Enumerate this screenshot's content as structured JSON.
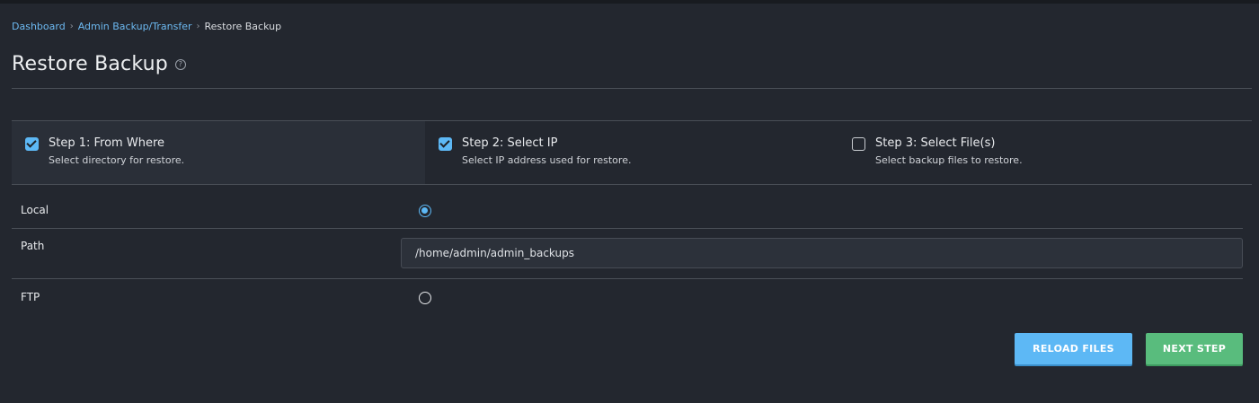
{
  "breadcrumb": {
    "items": [
      "Dashboard",
      "Admin Backup/Transfer"
    ],
    "current": "Restore Backup"
  },
  "page": {
    "title": "Restore Backup"
  },
  "steps": [
    {
      "title": "Step 1: From Where",
      "desc": "Select directory for restore.",
      "checked": true,
      "active": true
    },
    {
      "title": "Step 2: Select IP",
      "desc": "Select IP address used for restore.",
      "checked": true,
      "active": false
    },
    {
      "title": "Step 3: Select File(s)",
      "desc": "Select backup files to restore.",
      "checked": false,
      "active": false
    }
  ],
  "form": {
    "local_label": "Local",
    "local_selected": true,
    "path_label": "Path",
    "path_value": "/home/admin/admin_backups",
    "ftp_label": "FTP",
    "ftp_selected": false
  },
  "actions": {
    "reload_label": "RELOAD FILES",
    "next_label": "NEXT STEP"
  },
  "colors": {
    "background": "#23272f",
    "accent_blue": "#5db8f5",
    "accent_green": "#59bc7d",
    "link": "#6cb8f0"
  }
}
